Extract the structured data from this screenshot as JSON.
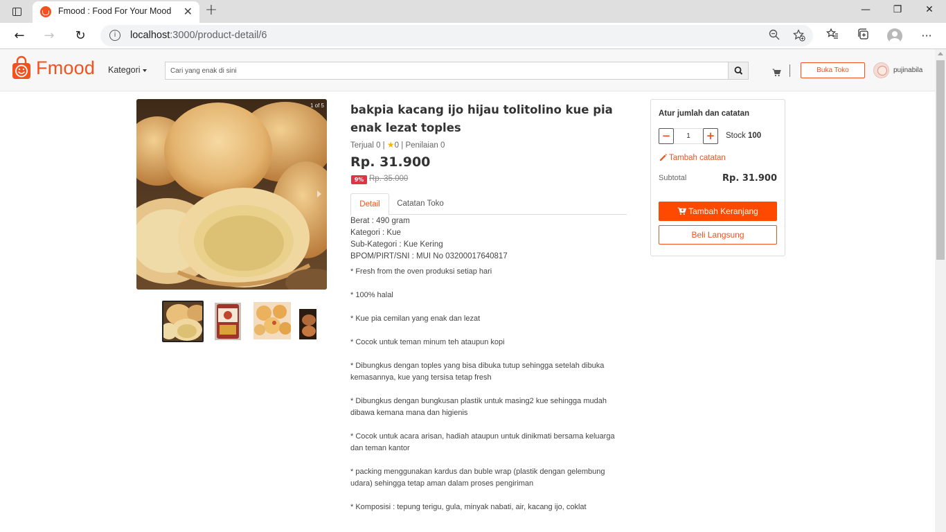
{
  "browser": {
    "tab_title": "Fmood : Food For Your Mood",
    "url_host": "localhost",
    "url_rest": ":3000/product-detail/6",
    "close_glyph": "✕",
    "new_tab_glyph": "+",
    "minimize_glyph": "—",
    "maximize_glyph": "❐",
    "window_close_glyph": "✕",
    "back_glyph": "←",
    "forward_glyph": "→",
    "reload_glyph": "↻",
    "more_glyph": "···",
    "info_glyph": "i"
  },
  "header": {
    "brand": "Fmood",
    "kategori_label": "Kategori",
    "search_placeholder": "Cari yang enak di sini",
    "open_store_label": "Buka Toko",
    "username": "pujinabila"
  },
  "gallery": {
    "counter": "1 of 5",
    "thumb_count": 4
  },
  "product": {
    "title": "bakpia kacang ijo hijau tolitolino kue pia enak lezat toples",
    "sold_label": "Terjual 0",
    "rating_value": "0",
    "reviews_label": "Penilaian 0",
    "separator": "|",
    "price": "Rp. 31.900",
    "discount": "9%",
    "old_price": "Rp. 35.000"
  },
  "tabs": [
    {
      "label": "Detail",
      "active": true
    },
    {
      "label": "Catatan Toko",
      "active": false
    }
  ],
  "specs": [
    "Berat : 490 gram",
    "Kategori : Kue",
    "Sub-Kategori : Kue Kering",
    "BPOM/PIRT/SNI : MUI No 03200017640817"
  ],
  "description": [
    "* Fresh from the oven produksi setiap hari",
    "* 100% halal",
    "* Kue pia cemilan yang enak dan lezat",
    "* Cocok untuk teman minum teh ataupun kopi",
    "* Dibungkus dengan toples yang bisa dibuka tutup sehingga setelah dibuka kemasannya, kue yang tersisa tetap fresh",
    "* Dibungkus dengan bungkusan plastik untuk masing2 kue sehingga mudah dibawa kemana mana dan higienis",
    "* Cocok untuk acara arisan, hadiah ataupun untuk dinikmati bersama keluarga dan teman kantor",
    "* packing menggunakan kardus dan buble wrap (plastik dengan gelembung udara) sehingga tetap aman dalam proses pengiriman",
    "* Komposisi : tepung terigu, gula, minyak nabati, air, kacang ijo, coklat"
  ],
  "purchase": {
    "title": "Atur jumlah dan catatan",
    "minus": "−",
    "plus": "+",
    "quantity": "1",
    "stock_label": "Stock",
    "stock_value": "100",
    "add_note_label": "Tambah catatan",
    "subtotal_label": "Subtotal",
    "subtotal_value": "Rp. 31.900",
    "add_to_cart_label": "Tambah Keranjang",
    "buy_now_label": "Beli Langsung"
  },
  "colors": {
    "brand": "#f4511e",
    "cart_button": "#fe4a00",
    "discount_badge": "#dc3545",
    "star": "#f5b400"
  }
}
